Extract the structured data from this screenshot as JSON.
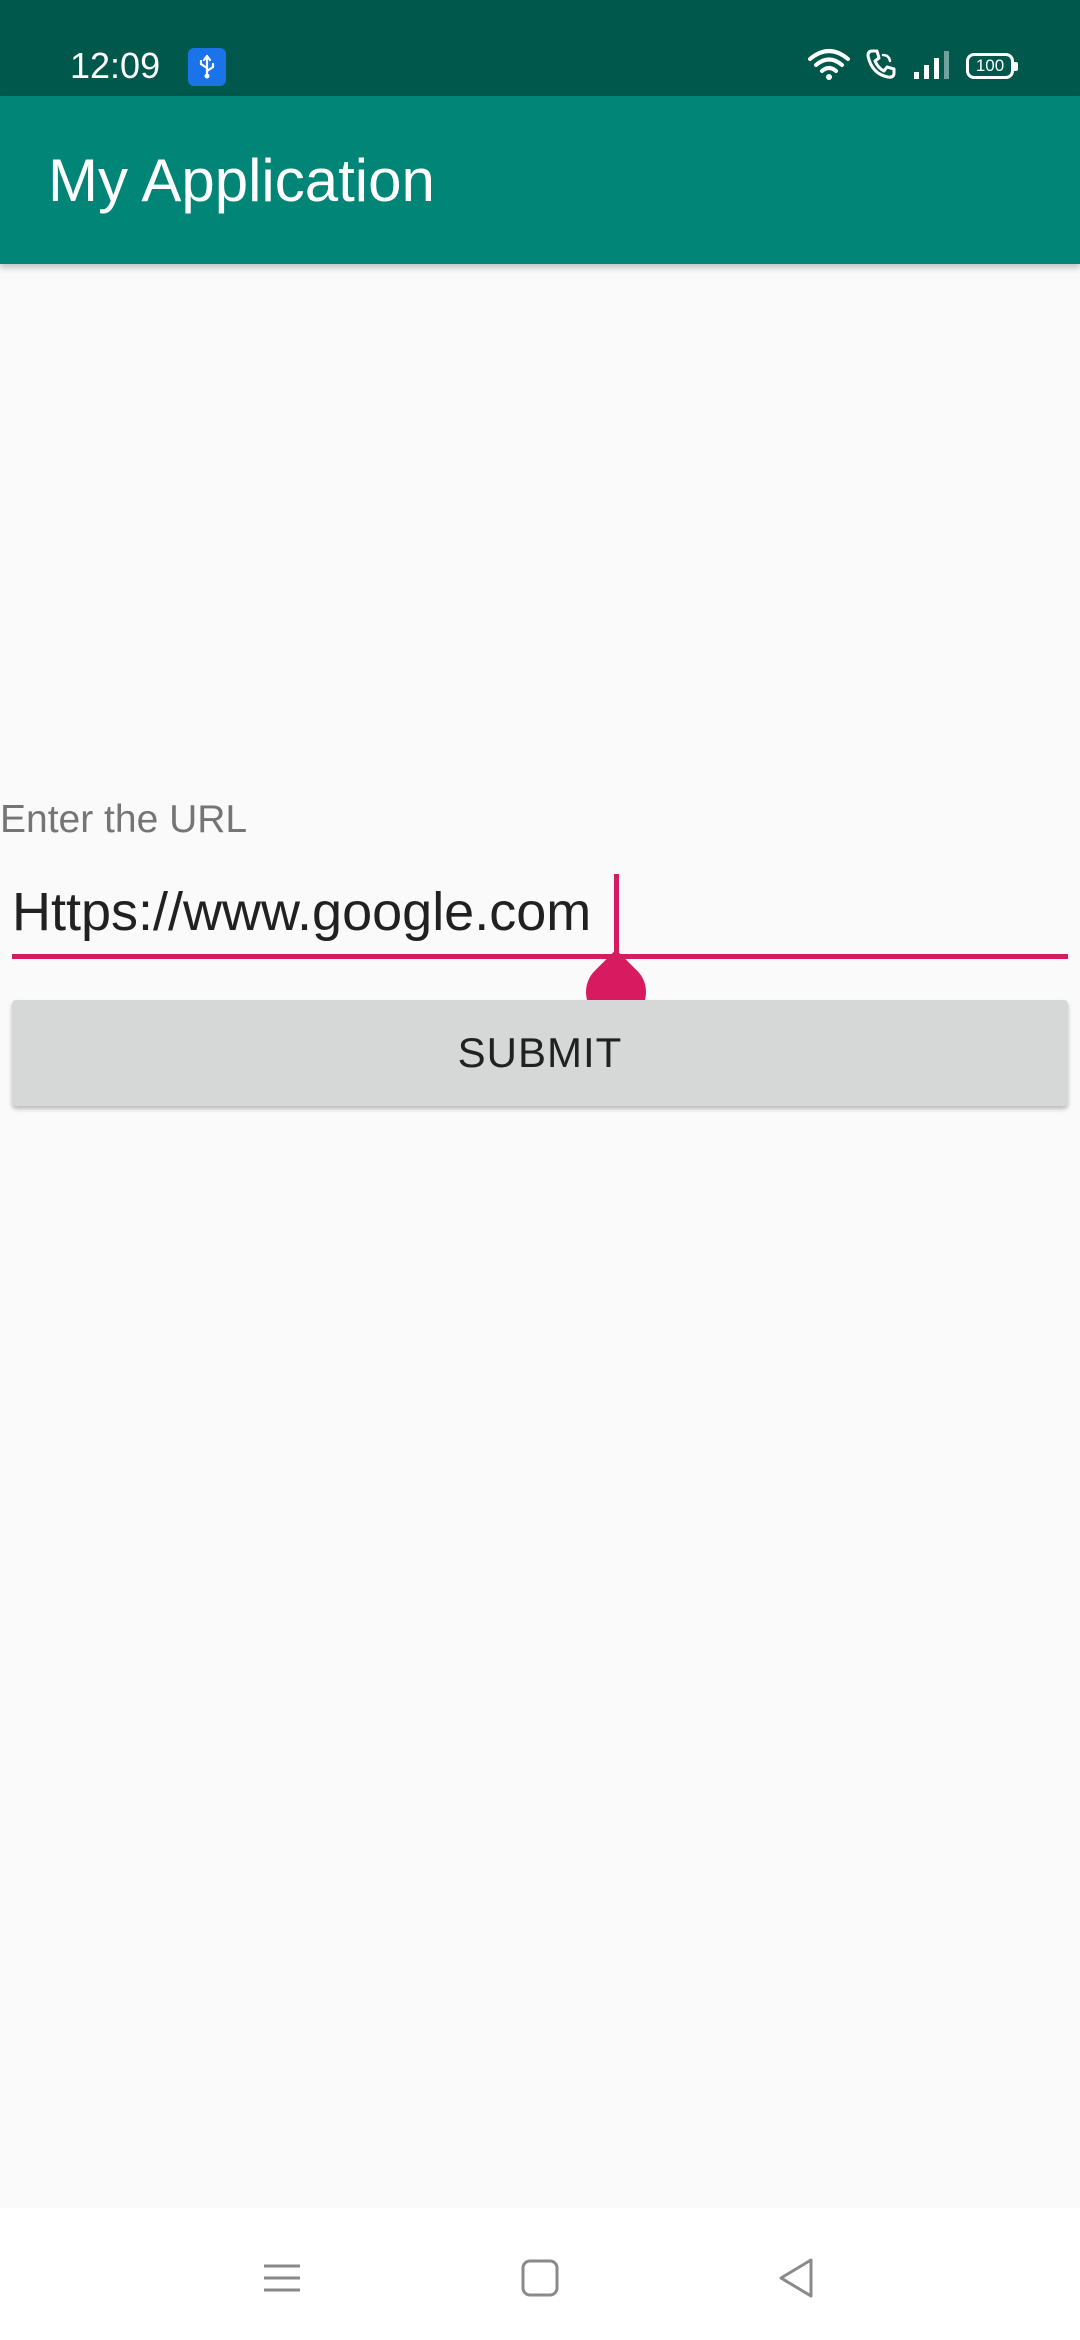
{
  "status_bar": {
    "time": "12:09",
    "battery": "100",
    "icons": [
      "usb-icon",
      "wifi-icon",
      "wifi-call-icon",
      "signal-icon",
      "battery-icon"
    ]
  },
  "app_bar": {
    "title": "My Application"
  },
  "form": {
    "prompt": "Enter the URL",
    "url_value": "Https://www.google.com",
    "submit_label": "SUBMIT"
  },
  "nav_bar": {
    "icons": [
      "menu-icon",
      "home-icon",
      "back-icon"
    ]
  },
  "colors": {
    "status_bar": "#00574b",
    "app_bar": "#008577",
    "accent": "#d81b60",
    "background": "#fafafa",
    "button": "#d6d7d7"
  }
}
